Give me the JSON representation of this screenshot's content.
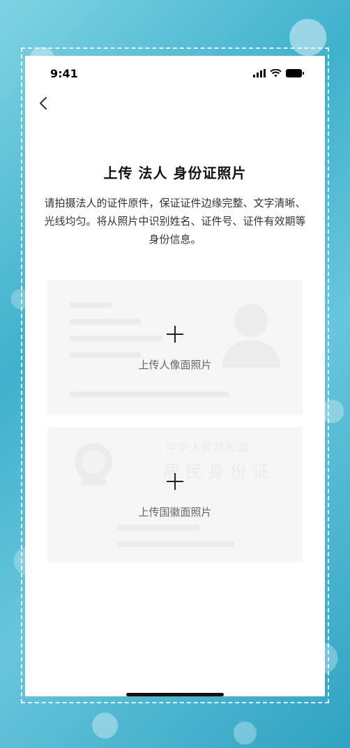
{
  "status_bar": {
    "time": "9:41"
  },
  "page": {
    "title": "上传 法人 身份证照片",
    "description": "请拍摄法人的证件原件，保证证件边缘完整、文字清晰、光线均匀。将从照片中识别姓名、证件号、证件有效期等身份信息。"
  },
  "cards": {
    "portrait": {
      "label": "上传人像面照片"
    },
    "emblem": {
      "label": "上传国徽面照片",
      "watermark_top": "中华人民共和国",
      "watermark_main": "居民身份证"
    }
  },
  "colors": {
    "accent": "#5cc0d6",
    "card_bg": "#f6f6f6"
  }
}
